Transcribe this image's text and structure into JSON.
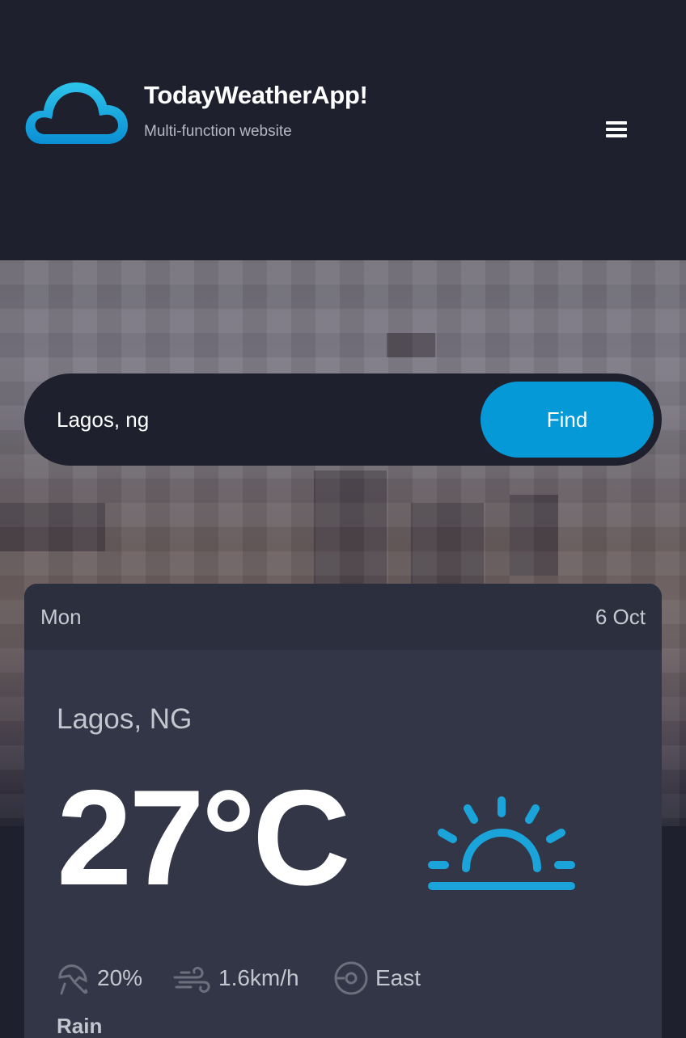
{
  "header": {
    "title": "TodayWeatherApp!",
    "description": "Multi-function website"
  },
  "search": {
    "value": "Lagos, ng",
    "button_label": "Find"
  },
  "weather": {
    "day": "Mon",
    "date": "6 Oct",
    "location": "Lagos, NG",
    "temperature": "27°C",
    "icon": "sunrise-icon",
    "precipitation": "20%",
    "wind_speed": "1.6km/h",
    "wind_direction": "East",
    "condition": "Rain"
  },
  "colors": {
    "background": "#1e202d",
    "accent": "#059ad7",
    "card": "#323646"
  }
}
